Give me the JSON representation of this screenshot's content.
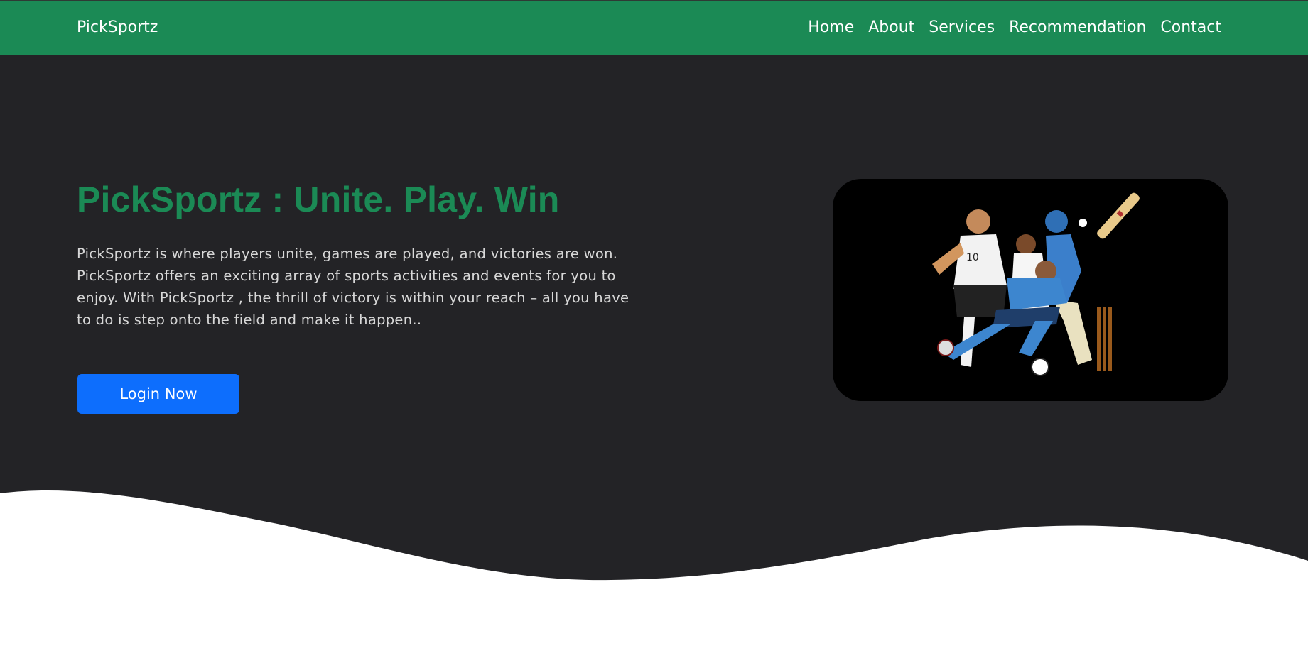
{
  "navbar": {
    "brand": "PickSportz",
    "links": [
      "Home",
      "About",
      "Services",
      "Recommendation",
      "Contact"
    ]
  },
  "hero": {
    "title": "PickSportz : Unite. Play. Win",
    "description": "PickSportz is where players unite, games are played, and victories are won. PickSportz offers an exciting array of sports activities and events for you to enjoy. With PickSportz , the thrill of victory is within your reach – all you have to do is step onto the field and make it happen..",
    "login_label": "Login Now",
    "image_subject": "sports-players-illustration",
    "jersey_number": "10"
  },
  "colors": {
    "primary_green": "#1b8a55",
    "background_dark": "#232326",
    "button_blue": "#0d6efd",
    "text_light": "#d8d8d8",
    "wave_white": "#ffffff"
  }
}
